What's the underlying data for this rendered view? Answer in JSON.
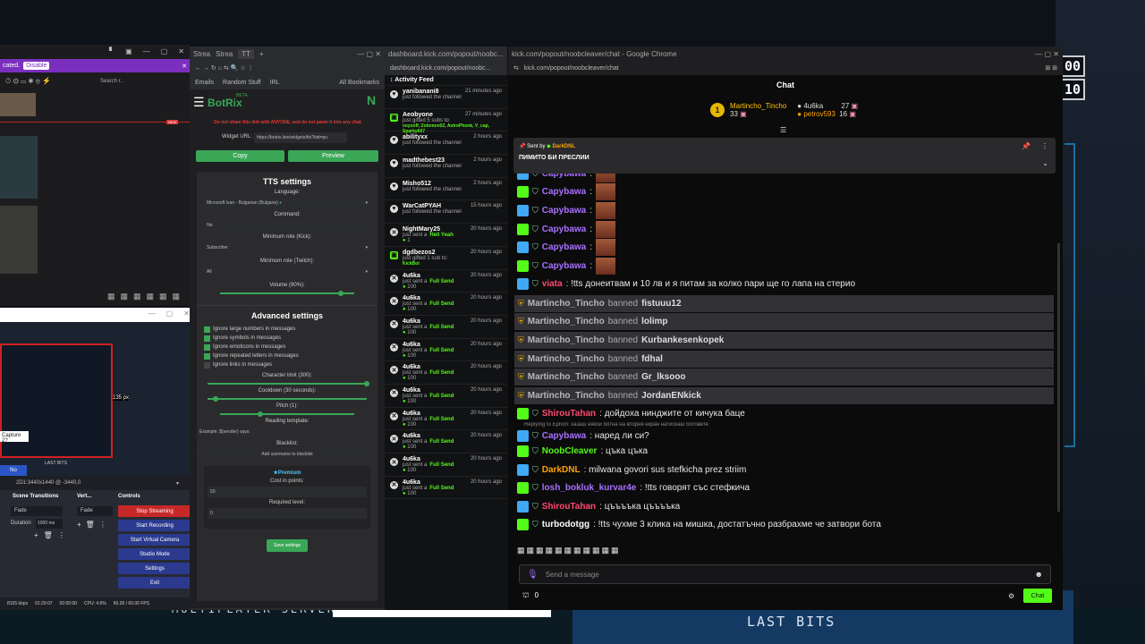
{
  "overlay": {
    "score_top": "00",
    "score_bottom": "10",
    "multiplayer": "MULTIPLAYER SERVERS",
    "last_bits": "LAST BITS"
  },
  "topleft": {
    "status": "cated.",
    "disable": "Disable",
    "search": "Search r..",
    "new": "NEW"
  },
  "capture": {
    "capture_text": "Capture 2?",
    "no_button": "No",
    "px_label": "135 px",
    "last_bits_small": "LAST BITS",
    "resolution": "2D1:3440x1440 @ -3440,0"
  },
  "obs": {
    "scene_transitions": "Scene Transitions",
    "vert": "Vert...",
    "controls": "Controls",
    "fade": "Fade",
    "duration_label": "Duration",
    "duration_value": "1000 ms",
    "buttons": [
      "Stop Streaming",
      "Start Recording",
      "Start Virtual Camera",
      "Studio Mode",
      "Settings",
      "Exit"
    ],
    "status": {
      "kbps": "8155 kbps",
      "time1": "01:29:07",
      "time2": "00:00:00",
      "cpu": "CPU: 4.6%",
      "fps": "60.00 / 60.00 FPS"
    }
  },
  "botrix": {
    "tabs": [
      "Strea",
      "Strea",
      "TT"
    ],
    "bookmarks": [
      "Emails",
      "Random Stuff",
      "IRL",
      "All Bookmarks"
    ],
    "title": "BotRix",
    "beta": "BETA",
    "warning": "Do not share this link with ANYONE, and do not paste it into any chat.",
    "widget_url_label": "Widget URL:",
    "widget_url": "https://botrix.live/widgets/tts?bid=pu",
    "copy": "Copy",
    "preview": "Preview",
    "tts_title": "TTS settings",
    "language_label": "Language:",
    "language_value": "Microsoft Ivan - Bulgarian (Bulgaria)",
    "command_label": "Command:",
    "command_value": "!tts",
    "min_role_kick_label": "Minimum role (Kick):",
    "min_role_kick_value": "Subscriber",
    "min_role_twitch_label": "Minimum role (Twitch):",
    "min_role_twitch_value": "All",
    "volume_label": "Volume (90%):",
    "volume_value": 0.9,
    "advanced_title": "Advanced settings",
    "checks": [
      {
        "label": "Ignore large numbers in messages",
        "on": true
      },
      {
        "label": "Ignore symbols in messages",
        "on": true
      },
      {
        "label": "Ignore emoticons in messages",
        "on": true
      },
      {
        "label": "Ignore repeated letters in messages",
        "on": true
      },
      {
        "label": "Ignore links in messages",
        "on": false
      }
    ],
    "char_limit_label": "Character limit (300):",
    "char_limit_value": 1.0,
    "cooldown_label": "Cooldown (30 seconds):",
    "cooldown_value": 0.05,
    "pitch_label": "Pitch (1):",
    "pitch_value": 0.3,
    "reading_template_label": "Reading template:",
    "reading_template_value": "Example: ${sender} says:",
    "blacklist_label": "Blacklist:",
    "blacklist_placeholder": "Add username to blacklist",
    "premium": "Premium",
    "cost_label": "Cost in points:",
    "cost_value": "50",
    "required_level_label": "Required level:",
    "required_level_value": "0",
    "save": "Save settings"
  },
  "feed": {
    "url": "dashboard.kick.com/popout/noobc...",
    "title": "Activity Feed",
    "items": [
      {
        "name": "yanibanani8",
        "time": "21 minutes ago",
        "text": "just followed the channel",
        "extra": "",
        "icon": "♥"
      },
      {
        "name": "Aeobyone",
        "time": "27 minutes ago",
        "text": "just gifted 5 subs to:",
        "extra": "voyxoff, Zolomon02, AstroPhonk, V_cap, Sparky667",
        "icon": "▣"
      },
      {
        "name": "abilityxx",
        "time": "2 hours ago",
        "text": "just followed the channel",
        "extra": "",
        "icon": "♥"
      },
      {
        "name": "madthebest23",
        "time": "2 hours ago",
        "text": "just followed the channel",
        "extra": "",
        "icon": "♥"
      },
      {
        "name": "Misho512",
        "time": "2 hours ago",
        "text": "just followed the channel",
        "extra": "",
        "icon": "♥"
      },
      {
        "name": "WarCatPYAH",
        "time": "15 hours ago",
        "text": "just followed the channel",
        "extra": "",
        "icon": "♥"
      },
      {
        "name": "NightMary25",
        "time": "20 hours ago",
        "text": "just sent a",
        "extra": "Hell Yeah",
        "pts": "1",
        "icon": "✕"
      },
      {
        "name": "dgdbezos2",
        "time": "20 hours ago",
        "text": "just gifted 1 sub to:",
        "extra": "KickBot",
        "icon": "▣"
      },
      {
        "name": "4u6ka",
        "time": "20 hours ago",
        "text": "just sent a",
        "extra": "Full Send",
        "pts": "100",
        "icon": "✕"
      },
      {
        "name": "4u6ka",
        "time": "20 hours ago",
        "text": "just sent a",
        "extra": "Full Send",
        "pts": "100",
        "icon": "✕"
      },
      {
        "name": "4u6ka",
        "time": "20 hours ago",
        "text": "just sent a",
        "extra": "Full Send",
        "pts": "100",
        "icon": "✕"
      },
      {
        "name": "4u6ka",
        "time": "20 hours ago",
        "text": "just sent a",
        "extra": "Full Send",
        "pts": "100",
        "icon": "✕"
      },
      {
        "name": "4u6ka",
        "time": "20 hours ago",
        "text": "just sent a",
        "extra": "Full Send",
        "pts": "100",
        "icon": "✕"
      },
      {
        "name": "4u6ka",
        "time": "20 hours ago",
        "text": "just sent a",
        "extra": "Full Send",
        "pts": "100",
        "icon": "✕"
      },
      {
        "name": "4u6ka",
        "time": "20 hours ago",
        "text": "just sent a",
        "extra": "Full Send",
        "pts": "100",
        "icon": "✕"
      },
      {
        "name": "4u6ka",
        "time": "20 hours ago",
        "text": "just sent a",
        "extra": "Full Send",
        "pts": "100",
        "icon": "✕"
      },
      {
        "name": "4u6ka",
        "time": "20 hours ago",
        "text": "just sent a",
        "extra": "Full Send",
        "pts": "100",
        "icon": "✕"
      },
      {
        "name": "4u6ka",
        "time": "20 hours ago",
        "text": "just sent a",
        "extra": "Full Send",
        "pts": "100",
        "icon": "✕"
      }
    ]
  },
  "chat": {
    "window_title": "kick.com/popout/noobcleaver/chat - Google Chrome",
    "url": "kick.com/popout/noobcleaver/chat",
    "title": "Chat",
    "leader1": {
      "name": "Martincho_Tincho",
      "count": "33"
    },
    "leader2": {
      "name": "4u6ka",
      "count": "27"
    },
    "leader3": {
      "name": "petrov593",
      "count": "16"
    },
    "pinned": {
      "sent_by": "Sent by",
      "author": "DarkDNL",
      "text": "ПИМИТО БИ ПРЕСЛИИ"
    },
    "messages": [
      {
        "type": "msg",
        "user": "Capybawa",
        "color": "#a970ff",
        "text": ":",
        "emote": true
      },
      {
        "type": "msg",
        "user": "Capybawa",
        "color": "#a970ff",
        "text": ":",
        "emote": true
      },
      {
        "type": "msg",
        "user": "Capybawa",
        "color": "#a970ff",
        "text": ":",
        "emote": true
      },
      {
        "type": "msg",
        "user": "Capybawa",
        "color": "#a970ff",
        "text": ":",
        "emote": true
      },
      {
        "type": "msg",
        "user": "Capybawa",
        "color": "#a970ff",
        "text": ":",
        "emote": true
      },
      {
        "type": "msg",
        "user": "Capybawa",
        "color": "#a970ff",
        "text": ":",
        "emote": true
      },
      {
        "type": "msg",
        "user": "viata",
        "color": "#ff4a6e",
        "text": ": !tts донеитвам и 10 лв и я питам за колко пари ще го лапа на стерио"
      },
      {
        "type": "ban",
        "user": "Martincho_Tincho",
        "action": "banned",
        "target": "fistuuu12"
      },
      {
        "type": "ban",
        "user": "Martincho_Tincho",
        "action": "banned",
        "target": "lolimp"
      },
      {
        "type": "ban",
        "user": "Martincho_Tincho",
        "action": "banned",
        "target": "Kurbankesenkopek"
      },
      {
        "type": "ban",
        "user": "Martincho_Tincho",
        "action": "banned",
        "target": "fdhal"
      },
      {
        "type": "ban",
        "user": "Martincho_Tincho",
        "action": "banned",
        "target": "Gr_lksooo"
      },
      {
        "type": "ban",
        "user": "Martincho_Tincho",
        "action": "banned",
        "target": "JordanENkick"
      },
      {
        "type": "msg",
        "user": "ShirouTahan",
        "color": "#ff4a6e",
        "text": ": дойдоха нинджите от кичука баце"
      },
      {
        "type": "reply",
        "reply": "Replying to Ephori: казаш някой ботна на вторня екран натискаш ботовете",
        "user": "Capybawa",
        "color": "#a970ff",
        "text": ": наред ли си?"
      },
      {
        "type": "msg",
        "user": "NoobCleaver",
        "color": "#53fc18",
        "text": ": цъка цъка"
      },
      {
        "type": "msg",
        "user": "DarkDNL",
        "color": "#ffa300",
        "text": ": milwana govori sus stefkicha prez striim"
      },
      {
        "type": "msg",
        "user": "losh_bokluk_kurvar4e",
        "color": "#a970ff",
        "text": ": !tts говорят със стефкича"
      },
      {
        "type": "msg",
        "user": "ShirouTahan",
        "color": "#ff4a6e",
        "text": ": цъъъъка цъъъъка"
      },
      {
        "type": "msg",
        "user": "turbodotgg",
        "color": "#ffffff",
        "text": ": !tts чухме 3 клика на мишка, достатъчно разбрахме че затвори бота"
      }
    ],
    "input_placeholder": "Send a message",
    "points": "0",
    "chat_button": "Chat"
  }
}
